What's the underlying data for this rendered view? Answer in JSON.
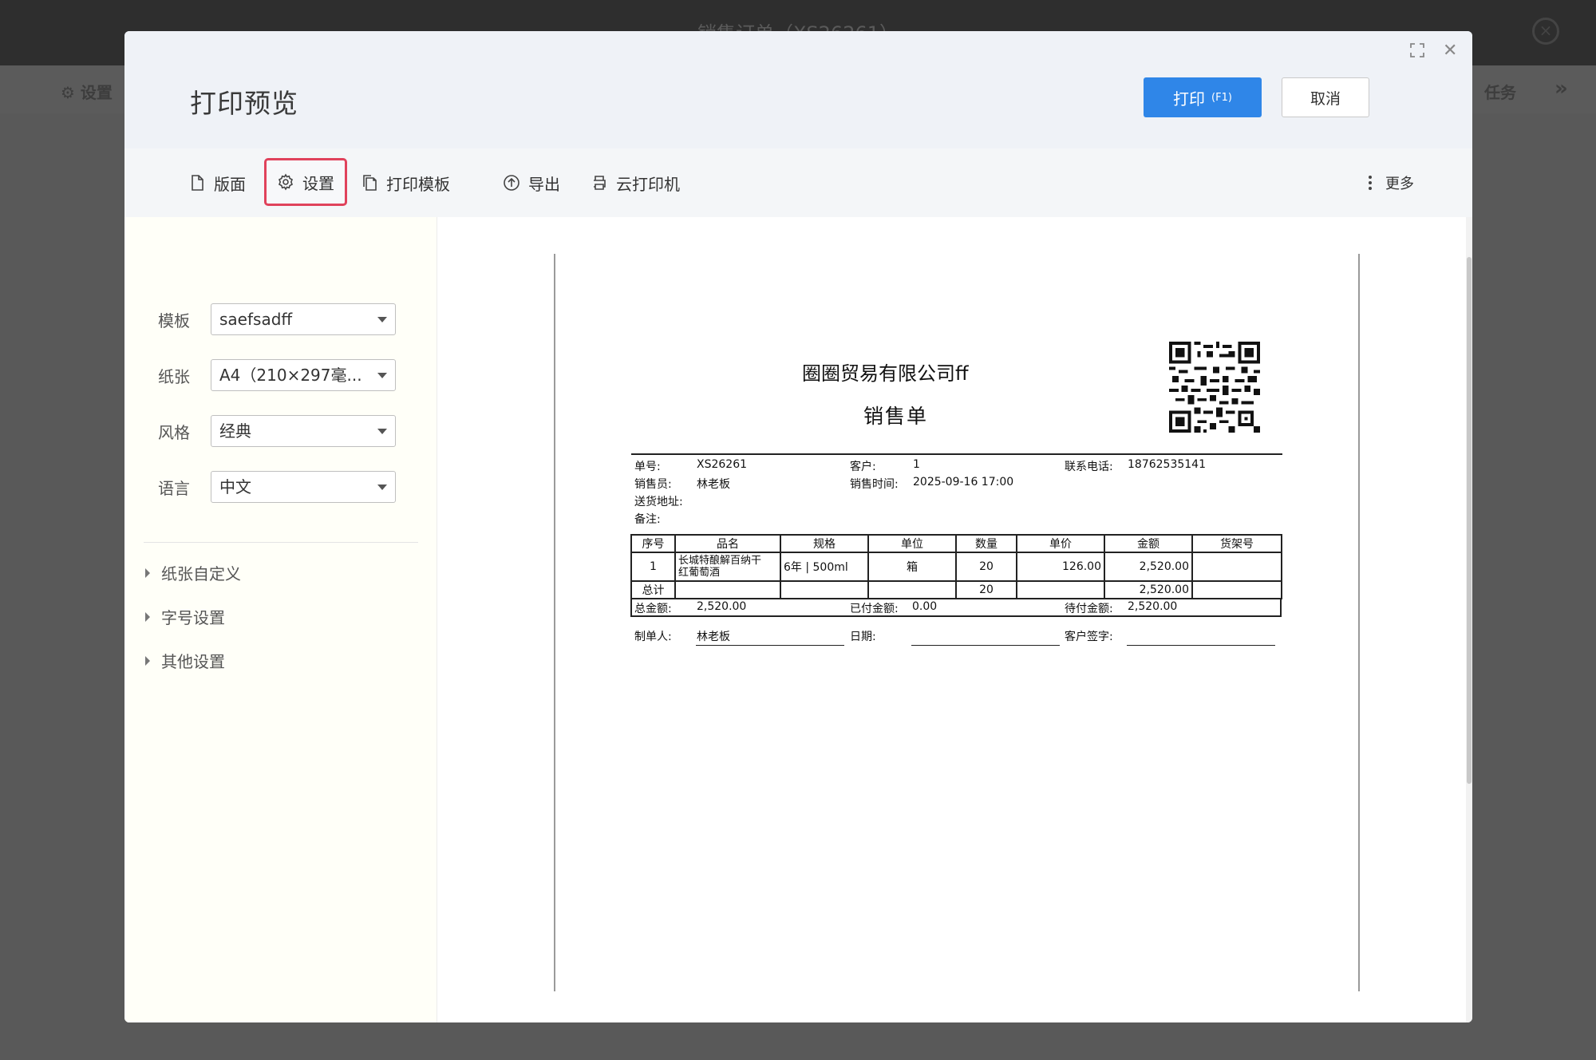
{
  "background": {
    "title": "销售订单（XS26261）",
    "settings_label": "设置",
    "task_label": "任务",
    "more_icon": "double-chevron-right-icon"
  },
  "modal": {
    "title": "打印预览",
    "print_button": "打印",
    "print_shortcut": "(F1)",
    "cancel_button": "取消"
  },
  "toolbar": {
    "layout": "版面",
    "settings": "设置",
    "template": "打印模板",
    "export": "导出",
    "cloud_printer": "云打印机",
    "more": "更多"
  },
  "settings_panel": {
    "template_label": "模板",
    "template_value": "saefsadff",
    "paper_label": "纸张",
    "paper_value": "A4（210×297毫...",
    "style_label": "风格",
    "style_value": "经典",
    "language_label": "语言",
    "language_value": "中文",
    "sections": [
      "纸张自定义",
      "字号设置",
      "其他设置"
    ]
  },
  "document": {
    "company": "圈圈贸易有限公司ff",
    "title": "销售单",
    "order_no_label": "单号:",
    "order_no": "XS26261",
    "customer_label": "客户:",
    "customer": "1",
    "phone_label": "联系电话:",
    "phone": "18762535141",
    "salesperson_label": "销售员:",
    "salesperson": "林老板",
    "sale_time_label": "销售时间:",
    "sale_time": "2025-09-16 17:00",
    "address_label": "送货地址:",
    "remark_label": "备注:",
    "columns": [
      "序号",
      "品名",
      "规格",
      "单位",
      "数量",
      "单价",
      "金额",
      "货架号"
    ],
    "rows": [
      {
        "no": "1",
        "name_line1": "长城特酿解百纳干",
        "name_line2": "红葡萄酒",
        "spec": "6年 | 500ml",
        "unit": "箱",
        "qty": "20",
        "price": "126.00",
        "amount": "2,520.00",
        "shelf": ""
      }
    ],
    "total_label": "总计",
    "total_qty": "20",
    "total_amount": "2,520.00",
    "grand_total_label": "总金额:",
    "grand_total": "2,520.00",
    "paid_label": "已付金额:",
    "paid": "0.00",
    "due_label": "待付金额:",
    "due": "2,520.00",
    "maker_label": "制单人:",
    "maker": "林老板",
    "date_label": "日期:",
    "signature_label": "客户签字:"
  }
}
